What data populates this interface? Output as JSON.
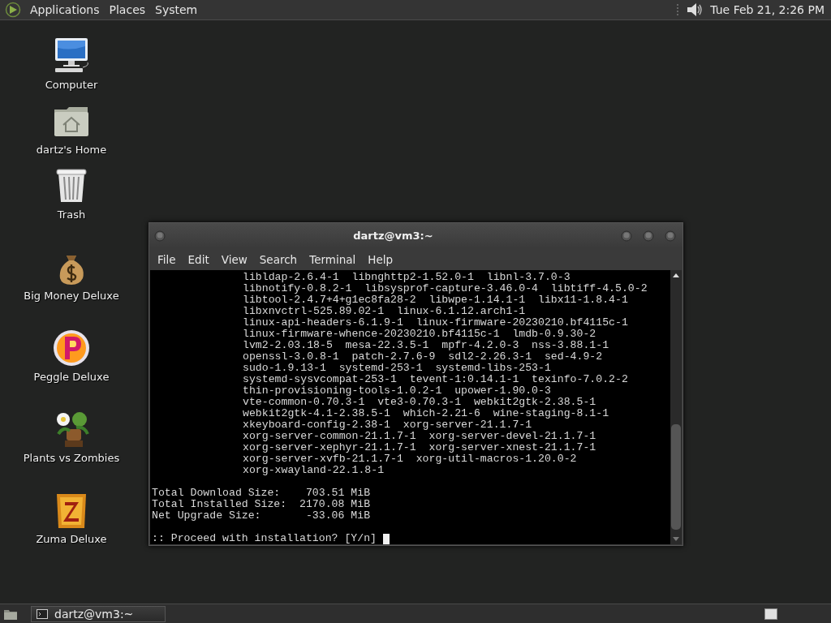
{
  "top_panel": {
    "menus": [
      "Applications",
      "Places",
      "System"
    ],
    "clock": "Tue Feb 21, 2:26 PM"
  },
  "desktop_icons": [
    {
      "label": "Computer",
      "kind": "computer"
    },
    {
      "label": "dartz's Home",
      "kind": "home"
    },
    {
      "label": "Trash",
      "kind": "trash"
    },
    {
      "label": "Big Money Deluxe",
      "kind": "money"
    },
    {
      "label": "Peggle Deluxe",
      "kind": "peggle"
    },
    {
      "label": "Plants vs Zombies",
      "kind": "plants"
    },
    {
      "label": "Zuma Deluxe",
      "kind": "zuma"
    }
  ],
  "terminal": {
    "title": "dartz@vm3:~",
    "menus": [
      "File",
      "Edit",
      "View",
      "Search",
      "Terminal",
      "Help"
    ],
    "packages": [
      "libldap-2.6.4-1  libnghttp2-1.52.0-1  libnl-3.7.0-3",
      "libnotify-0.8.2-1  libsysprof-capture-3.46.0-4  libtiff-4.5.0-2",
      "libtool-2.4.7+4+g1ec8fa28-2  libwpe-1.14.1-1  libx11-1.8.4-1",
      "libxnvctrl-525.89.02-1  linux-6.1.12.arch1-1",
      "linux-api-headers-6.1.9-1  linux-firmware-20230210.bf4115c-1",
      "linux-firmware-whence-20230210.bf4115c-1  lmdb-0.9.30-2",
      "lvm2-2.03.18-5  mesa-22.3.5-1  mpfr-4.2.0-3  nss-3.88.1-1",
      "openssl-3.0.8-1  patch-2.7.6-9  sdl2-2.26.3-1  sed-4.9-2",
      "sudo-1.9.13-1  systemd-253-1  systemd-libs-253-1",
      "systemd-sysvcompat-253-1  tevent-1:0.14.1-1  texinfo-7.0.2-2",
      "thin-provisioning-tools-1.0.2-1  upower-1.90.0-3",
      "vte-common-0.70.3-1  vte3-0.70.3-1  webkit2gtk-2.38.5-1",
      "webkit2gtk-4.1-2.38.5-1  which-2.21-6  wine-staging-8.1-1",
      "xkeyboard-config-2.38-1  xorg-server-21.1.7-1",
      "xorg-server-common-21.1.7-1  xorg-server-devel-21.1.7-1",
      "xorg-server-xephyr-21.1.7-1  xorg-server-xnest-21.1.7-1",
      "xorg-server-xvfb-21.1.7-1  xorg-util-macros-1.20.0-2",
      "xorg-xwayland-22.1.8-1"
    ],
    "summary": [
      "Total Download Size:    703.51 MiB",
      "Total Installed Size:  2170.08 MiB",
      "Net Upgrade Size:       -33.06 MiB"
    ],
    "prompt": ":: Proceed with installation? [Y/n]"
  },
  "taskbar": {
    "tasks": [
      {
        "label": "dartz@vm3:~",
        "selected": false
      }
    ]
  }
}
